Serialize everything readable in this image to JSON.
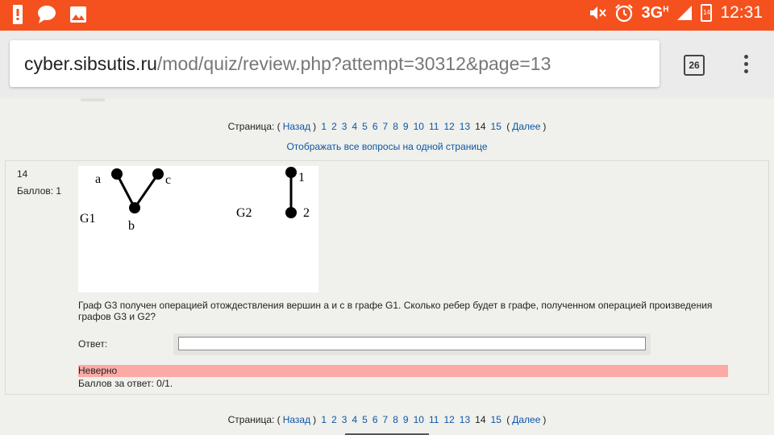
{
  "statusbar": {
    "left_icons": [
      "alert-icon",
      "chat-icon",
      "image-icon"
    ],
    "network": "3G",
    "network_sup": "H",
    "battery": "14",
    "time": "12:31"
  },
  "browser": {
    "url_host": "cyber.sibsutis.ru",
    "url_path": "/mod/quiz/review.php?attempt=30312&page=13",
    "tab_count": "26"
  },
  "pager": {
    "label": "Страница: (",
    "prev": "Назад",
    "pages": [
      "1",
      "2",
      "3",
      "4",
      "5",
      "6",
      "7",
      "8",
      "9",
      "10",
      "11",
      "12",
      "13",
      "14",
      "15"
    ],
    "current": "14",
    "next": "Далее",
    "close_paren": ")",
    "open_paren_next": "("
  },
  "show_all": "Отображать все вопросы на одной странице",
  "question": {
    "number": "14",
    "points": "Баллов: 1",
    "graph": {
      "g1_label": "G1",
      "g2_label": "G2",
      "g1_nodes": [
        "a",
        "b",
        "c"
      ],
      "g2_nodes": [
        "1",
        "2"
      ]
    },
    "text": "Граф G3 получен операцией отождествления вершин a и c в графе G1. Сколько ребер будет в графе, полученном операцией произведения графов G3 и G2?",
    "answer_label": "Ответ:",
    "answer_value": "",
    "feedback": "Неверно",
    "grade": "Баллов за ответ: 0/1.",
    "colors": {
      "incorrect_bg": "#fbaaa6"
    }
  },
  "colors": {
    "statusbar": "#f5511e",
    "link": "#0b57a6"
  }
}
